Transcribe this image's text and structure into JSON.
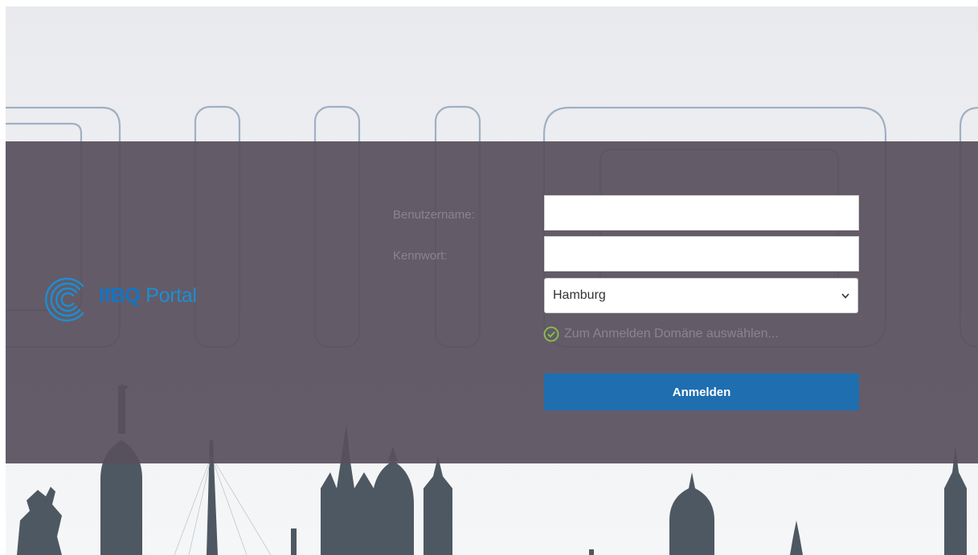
{
  "logo": {
    "brand": "IfBQ",
    "product": "Portal",
    "icon": "concentric-arcs-logo-icon",
    "colors": {
      "brand": "#1275c5",
      "product": "#1b8fd3"
    }
  },
  "form": {
    "username_label": "Benutzername:",
    "username_value": "",
    "password_label": "Kennwort:",
    "password_value": "",
    "domain_selected": "Hamburg",
    "domain_hint": "Zum Anmelden Domäne auswählen...",
    "hint_icon": "check-circle-icon",
    "submit_label": "Anmelden"
  },
  "colors": {
    "band": "#58505c",
    "button": "#1f6eb0",
    "label": "#8b8390",
    "check": "#8bc34a",
    "skyline": "#4e5862"
  }
}
